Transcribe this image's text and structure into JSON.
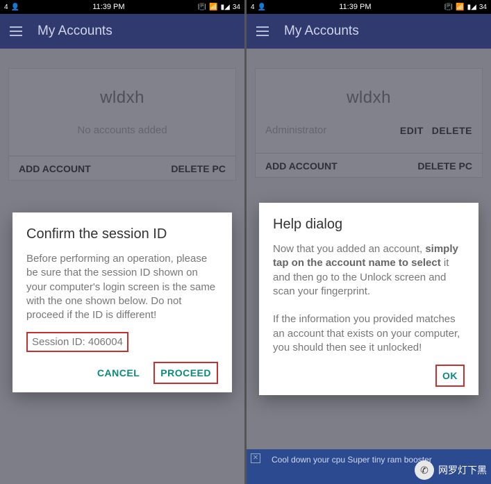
{
  "status": {
    "left_badge": "4",
    "time": "11:39 PM",
    "battery": "34"
  },
  "app": {
    "title": "My Accounts"
  },
  "left": {
    "card": {
      "title": "wldxh",
      "empty_text": "No accounts added",
      "add": "ADD ACCOUNT",
      "delete": "DELETE PC"
    },
    "dialog": {
      "title": "Confirm the session ID",
      "body": "Before performing an operation, please be sure that the session ID shown on your computer's login screen is the same with the one shown below. Do not proceed if the ID is different!",
      "session_label": "Session ID:",
      "session_value": "406004",
      "cancel": "CANCEL",
      "proceed": "PROCEED"
    }
  },
  "right": {
    "card": {
      "title": "wldxh",
      "admin": "Administrator",
      "edit": "EDIT",
      "del": "DELETE",
      "add": "ADD ACCOUNT",
      "delete_pc": "DELETE PC"
    },
    "dialog": {
      "title": "Help dialog",
      "body_pre": "Now that you added an account, ",
      "body_bold": "simply tap on the account name to select",
      "body_post": " it and then go to the Unlock screen and scan your fingerprint.",
      "body2": "If the information you provided matches an account that exists on your computer, you should then see it unlocked!",
      "ok": "OK"
    },
    "ad": "Cool down your cpu Super tiny ram booster"
  },
  "watermark": "网罗灯下黑"
}
